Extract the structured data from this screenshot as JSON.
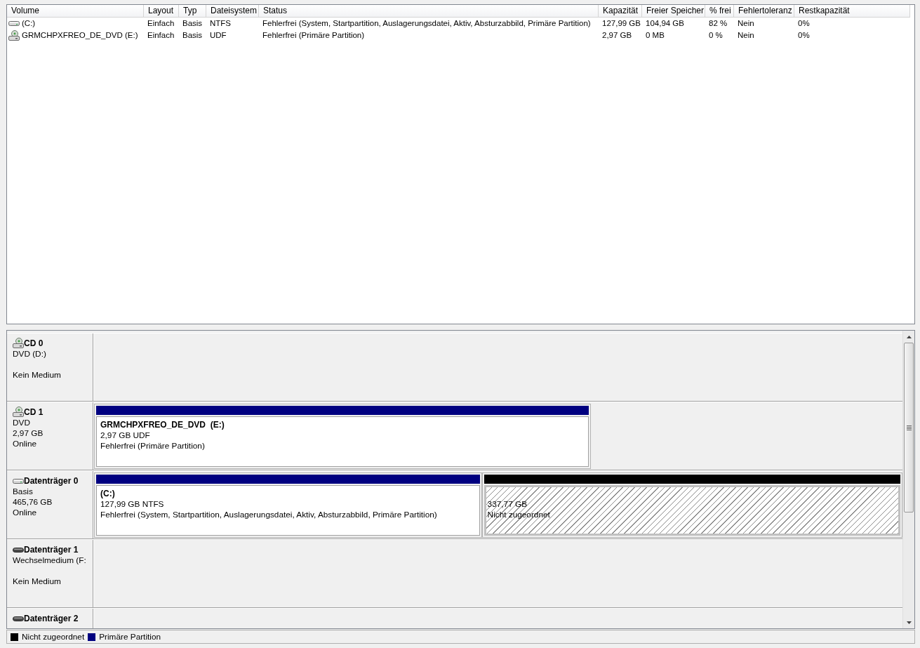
{
  "volume_list": {
    "columns": [
      "Volume",
      "Layout",
      "Typ",
      "Dateisystem",
      "Status",
      "Kapazität",
      "Freier Speicher",
      "% frei",
      "Fehlertoleranz",
      "Restkapazität"
    ],
    "rows": [
      {
        "kind": "hdd",
        "cells": [
          "(C:)",
          "Einfach",
          "Basis",
          "NTFS",
          "Fehlerfrei (System, Startpartition, Auslagerungsdatei, Aktiv, Absturzabbild, Primäre Partition)",
          "127,99 GB",
          "104,94 GB",
          "82 %",
          "Nein",
          "0%"
        ]
      },
      {
        "kind": "optical",
        "cells": [
          "GRMCHPXFREO_DE_DVD (E:)",
          "Einfach",
          "Basis",
          "UDF",
          "Fehlerfrei (Primäre Partition)",
          "2,97 GB",
          "0 MB",
          "0 %",
          "Nein",
          "0%"
        ]
      }
    ]
  },
  "disks": [
    {
      "kind": "optical",
      "name": "CD 0",
      "type": "DVD (D:)",
      "status": "Kein Medium"
    },
    {
      "kind": "optical",
      "name": "CD 1",
      "type": "DVD",
      "size": "2,97 GB",
      "status": "Online",
      "partitions": [
        {
          "kind": "primary",
          "title": "GRMCHPXFREO_DE_DVD  (E:)",
          "size": "2,97 GB UDF",
          "status": "Fehlerfrei (Primäre Partition)"
        }
      ]
    },
    {
      "kind": "hdd",
      "name": "Datenträger 0",
      "type": "Basis",
      "size": "465,76 GB",
      "status": "Online",
      "partitions": [
        {
          "kind": "primary",
          "title": "(C:)",
          "size": "127,99 GB NTFS",
          "status": "Fehlerfrei (System, Startpartition, Auslagerungsdatei, Aktiv, Absturzabbild, Primäre Partition)"
        },
        {
          "kind": "unallocated",
          "size": "337,77 GB",
          "status": "Nicht zugeordnet"
        }
      ]
    },
    {
      "kind": "removable",
      "name": "Datenträger 1",
      "type": "Wechselmedium (F:",
      "status": "Kein Medium"
    },
    {
      "kind": "removable",
      "name": "Datenträger 2"
    }
  ],
  "legend": [
    {
      "label": "Nicht zugeordnet",
      "color": "#000000"
    },
    {
      "label": "Primäre Partition",
      "color": "#000080"
    }
  ]
}
